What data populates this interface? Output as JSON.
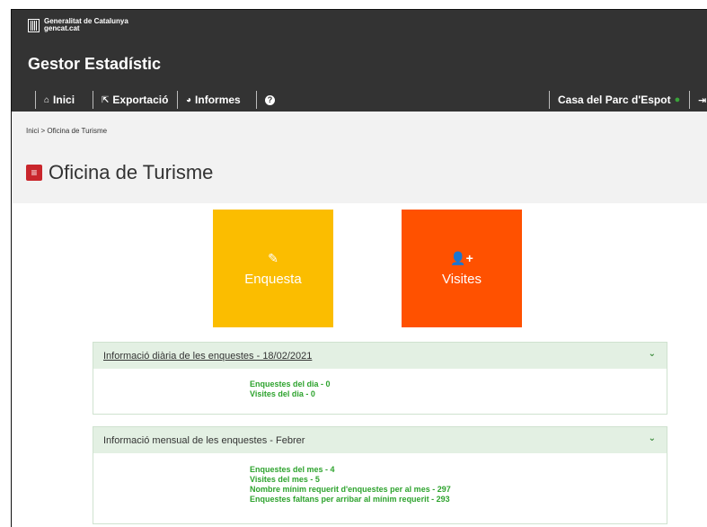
{
  "brand": {
    "org_line1": "Generalitat de Catalunya",
    "org_line2": "gencat.cat",
    "app_title": "Gestor Estadístic"
  },
  "nav": {
    "items": [
      {
        "label": "Inici",
        "icon": "home-icon"
      },
      {
        "label": "Exportació",
        "icon": "export-icon"
      },
      {
        "label": "Informes",
        "icon": "pie-chart-icon"
      },
      {
        "label": "",
        "icon": "help-icon"
      }
    ],
    "user": "Casa del Parc d'Espot",
    "user_icon": "user-icon",
    "logout_icon": "logout-icon"
  },
  "breadcrumb": {
    "home": "Inici",
    "separator": ">",
    "current": "Oficina de Turisme"
  },
  "page": {
    "title": "Oficina de Turisme",
    "title_icon": "menu-icon"
  },
  "tiles": [
    {
      "label": "Enquesta",
      "icon": "edit-icon",
      "color": "#fbbd00"
    },
    {
      "label": "Visites",
      "icon": "add-user-icon",
      "color": "#ff5100"
    }
  ],
  "daily": {
    "header": "Informació diària de les enquestes - 18/02/2021",
    "lines": [
      "Enquestes del dia - 0",
      "Visites del dia - 0"
    ]
  },
  "monthly": {
    "header": "Informació mensual de les enquestes - Febrer",
    "lines": [
      "Enquestes del mes - 4",
      "Visites del mes - 5",
      "Nombre mínim requerit d'enquestes per al mes - 297",
      "Enquestes faltans per arribar al mínim requerit - 293"
    ]
  },
  "colors": {
    "topbar": "#333333",
    "accent_red": "#c9262c",
    "panel_header": "#e3f0e3",
    "stat_green": "#2ea32e"
  }
}
